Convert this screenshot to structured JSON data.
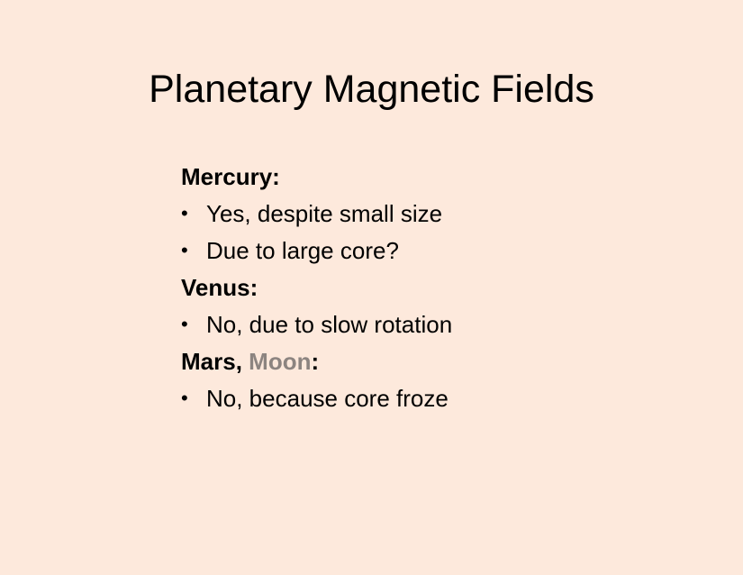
{
  "slide": {
    "title": "Planetary Magnetic Fields",
    "background_color": "#fde9dc",
    "muted_color": "#8c8480",
    "bullet_glyph": "•",
    "sections": {
      "mercury": {
        "heading": "Mercury:",
        "bullets": [
          "Yes, despite small size",
          "Due to large core?"
        ]
      },
      "venus": {
        "heading": "Venus:",
        "bullets": [
          "No, due to slow rotation"
        ]
      },
      "mars_moon": {
        "heading_part1": "Mars, ",
        "heading_part2": "Moon",
        "heading_part3": ":",
        "bullets": [
          "No, because core froze"
        ]
      }
    }
  }
}
